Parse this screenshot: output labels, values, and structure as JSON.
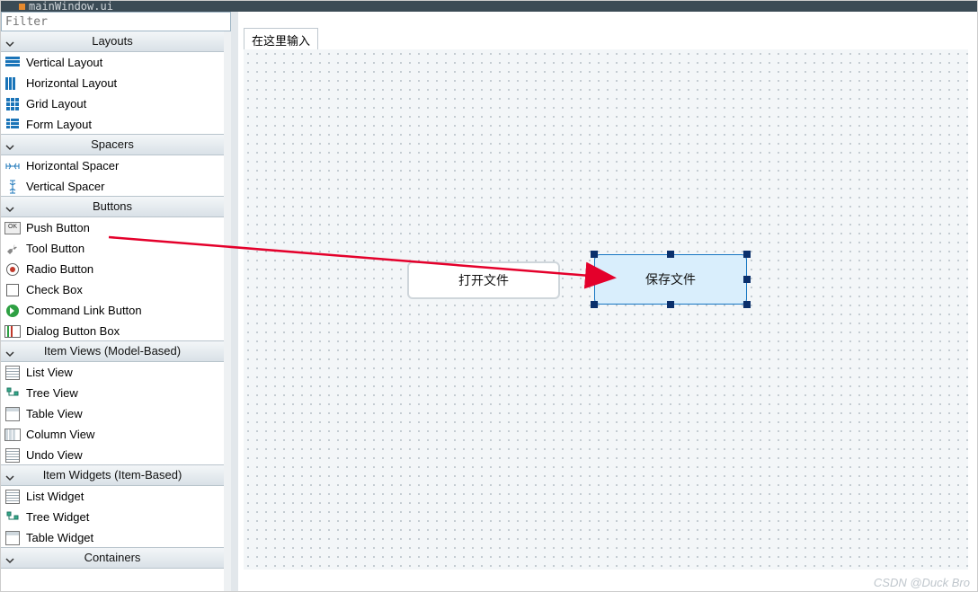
{
  "titlebar": {
    "filename": "mainWindow.ui"
  },
  "filter": {
    "placeholder": "Filter"
  },
  "sidebar": {
    "cats": [
      {
        "label": "Layouts"
      },
      {
        "label": "Spacers"
      },
      {
        "label": "Buttons"
      },
      {
        "label": "Item Views (Model-Based)"
      },
      {
        "label": "Item Widgets (Item-Based)"
      },
      {
        "label": "Containers"
      }
    ],
    "layouts": [
      {
        "label": "Vertical Layout"
      },
      {
        "label": "Horizontal Layout"
      },
      {
        "label": "Grid Layout"
      },
      {
        "label": "Form Layout"
      }
    ],
    "spacers": [
      {
        "label": "Horizontal Spacer"
      },
      {
        "label": "Vertical Spacer"
      }
    ],
    "buttons": [
      {
        "label": "Push Button"
      },
      {
        "label": "Tool Button"
      },
      {
        "label": "Radio Button"
      },
      {
        "label": "Check Box"
      },
      {
        "label": "Command Link Button"
      },
      {
        "label": "Dialog Button Box"
      }
    ],
    "itemviews": [
      {
        "label": "List View"
      },
      {
        "label": "Tree View"
      },
      {
        "label": "Table View"
      },
      {
        "label": "Column View"
      },
      {
        "label": "Undo View"
      }
    ],
    "itemwidgets": [
      {
        "label": "List Widget"
      },
      {
        "label": "Tree Widget"
      },
      {
        "label": "Table Widget"
      }
    ]
  },
  "menubar": {
    "placeholder": "在这里输入"
  },
  "form": {
    "btn_open": "打开文件",
    "btn_save": "保存文件"
  },
  "watermark": "CSDN @Duck Bro"
}
